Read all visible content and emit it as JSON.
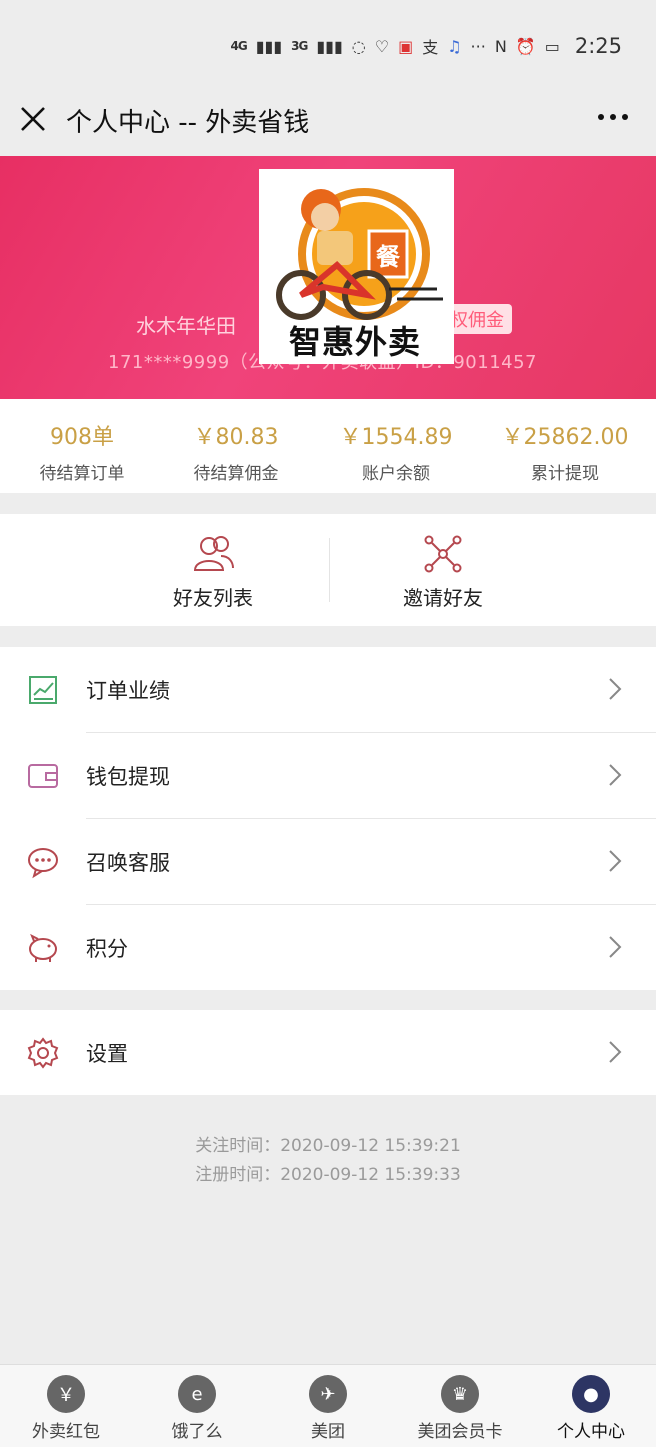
{
  "status_bar": {
    "signal1": "4G",
    "signal2": "3G",
    "time": "2:25"
  },
  "header": {
    "title": "个人中心 -- 外卖省钱"
  },
  "profile": {
    "name": "水木年华田",
    "badge": "权佣金",
    "phone": "171****9999（公众号：外卖联盟）ID：9011457",
    "logo_text": "智惠外卖",
    "logo_sign": "餐"
  },
  "stats": [
    {
      "value": "908单",
      "label": "待结算订单"
    },
    {
      "value": "￥80.83",
      "label": "待结算佣金"
    },
    {
      "value": "￥1554.89",
      "label": "账户余额"
    },
    {
      "value": "￥25862.00",
      "label": "累计提现"
    }
  ],
  "friends": {
    "list_label": "好友列表",
    "invite_label": "邀请好友"
  },
  "menu": [
    {
      "label": "订单业绩"
    },
    {
      "label": "钱包提现"
    },
    {
      "label": "召唤客服"
    },
    {
      "label": "积分"
    }
  ],
  "settings": {
    "label": "设置"
  },
  "footer": {
    "follow_time": "关注时间：2020-09-12 15:39:21",
    "register_time": "注册时间：2020-09-12 15:39:33"
  },
  "tabs": [
    {
      "label": "外卖红包",
      "glyph": "￥"
    },
    {
      "label": "饿了么",
      "glyph": "e"
    },
    {
      "label": "美团",
      "glyph": "✈"
    },
    {
      "label": "美团会员卡",
      "glyph": "♛"
    },
    {
      "label": "个人中心",
      "glyph": "●"
    }
  ],
  "colors": {
    "banner": "#e93a6b",
    "stat_gold": "#c9a046",
    "icon_red": "#b5484f",
    "active_tab": "#2d3564"
  }
}
